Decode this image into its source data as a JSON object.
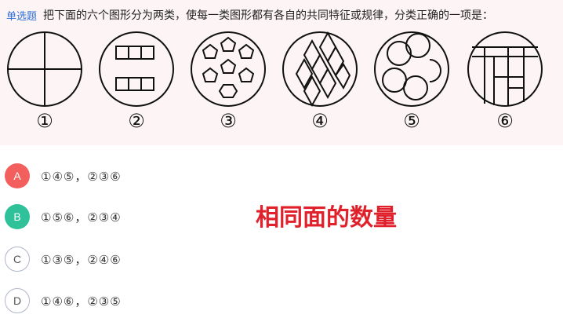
{
  "question": {
    "tag": "单选题",
    "text": "把下面的六个图形分为两类，使每一类图形都有各自的共同特征或规律，分类正确的一项是：",
    "figure_labels": [
      "①",
      "②",
      "③",
      "④",
      "⑤",
      "⑥"
    ]
  },
  "options": [
    {
      "letter": "A",
      "text": "①④⑤，②③⑥"
    },
    {
      "letter": "B",
      "text": "①⑤⑥，②③④"
    },
    {
      "letter": "C",
      "text": "①③⑤，②④⑥"
    },
    {
      "letter": "D",
      "text": "①④⑥，②③⑤"
    }
  ],
  "answer_note": "相同面的数量",
  "colors": {
    "selected_wrong": "#f25f5c",
    "correct": "#2ec19a",
    "note": "#e0212b",
    "tag": "#2f6fd6"
  }
}
